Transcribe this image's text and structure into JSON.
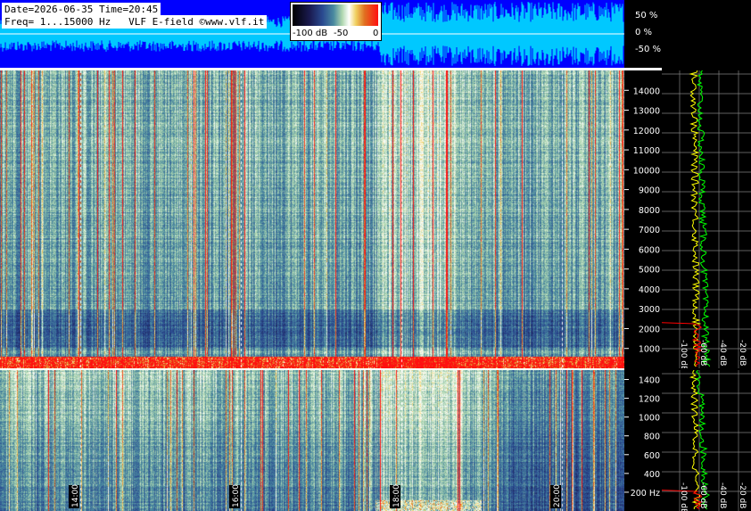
{
  "info": {
    "line1": "Date=2026-06-35 Time=20:45",
    "line2": "Freq= 1...15000 Hz   VLF E-field ©www.vlf.it"
  },
  "colorbar": {
    "labels": [
      "-100 dB",
      "-50",
      "0"
    ]
  },
  "chart_data": [
    {
      "type": "area",
      "name": "waveform amplitude",
      "y_ticks": [
        "50 %",
        "0 %",
        "-50 %"
      ],
      "ylim": [
        -100,
        100
      ],
      "colors": {
        "background": "#0000ff",
        "signal": "#00c8ff"
      }
    },
    {
      "type": "heatmap",
      "name": "spectrogram high band",
      "y_unit": "Hz",
      "y_ticks": [
        1000,
        2000,
        3000,
        4000,
        5000,
        6000,
        7000,
        8000,
        9000,
        10000,
        11000,
        12000,
        13000,
        14000
      ],
      "ylim": [
        0,
        15000
      ],
      "x_ticks": [
        "14:00",
        "16:00",
        "18:00",
        "20:00"
      ],
      "colorscale_db": [
        -100,
        0
      ]
    },
    {
      "type": "heatmap",
      "name": "spectrogram low band",
      "y_unit": "Hz",
      "y_ticks": [
        "200 Hz",
        "400",
        "600",
        "800",
        "1000",
        "1200",
        "1400"
      ],
      "ylim": [
        0,
        1500
      ],
      "x_ticks": [
        "14:00",
        "16:00",
        "18:00",
        "20:00"
      ]
    },
    {
      "type": "line",
      "name": "spectrum profile",
      "x_ticks": [
        "-100 dB",
        "-60 dB",
        "-40 dB",
        "-20 dB"
      ],
      "series_colors": [
        "#ffff00",
        "#00ff00",
        "#ff0000"
      ]
    }
  ]
}
